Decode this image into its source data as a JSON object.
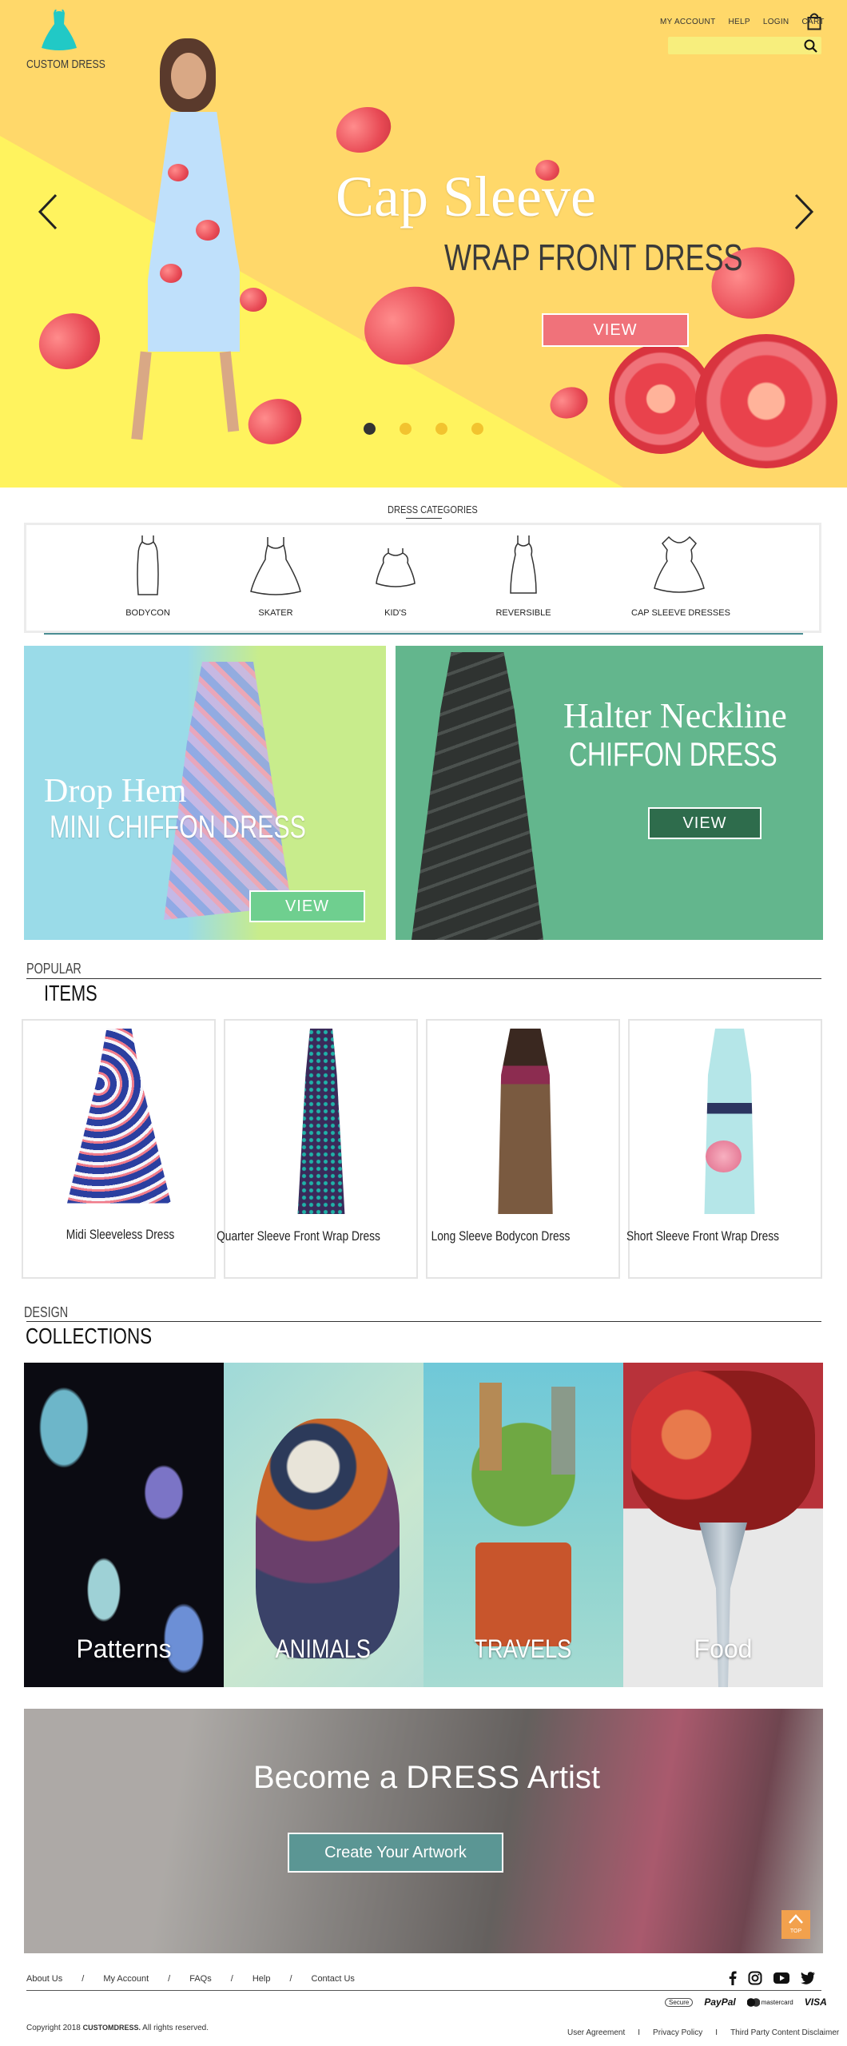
{
  "header": {
    "logo_text": "CUSTOM DRESS",
    "nav": [
      "MY ACCOUNT",
      "HELP",
      "LOGIN",
      "CART"
    ],
    "search_placeholder": ""
  },
  "hero": {
    "title": "Cap Sleeve",
    "subtitle": "WRAP FRONT DRESS",
    "button": "VIEW",
    "slides": 4,
    "active_slide": 1,
    "colors": {
      "bg": "#ffd86a",
      "accent": "#f0727a"
    }
  },
  "categories": {
    "heading": "DRESS CATEGORIES",
    "items": [
      {
        "label": "BODYCON",
        "icon": "bodycon-dress-icon"
      },
      {
        "label": "SKATER",
        "icon": "skater-dress-icon"
      },
      {
        "label": "KID'S",
        "icon": "kids-dress-icon"
      },
      {
        "label": "REVERSIBLE",
        "icon": "reversible-dress-icon"
      },
      {
        "label": "CAP SLEEVE DRESSES",
        "icon": "cap-sleeve-dress-icon"
      }
    ]
  },
  "promos": [
    {
      "title": "Drop Hem",
      "subtitle": "MINI CHIFFON DRESS",
      "button": "VIEW",
      "bg": "#9adbe8",
      "btn_color": "#6fcf8f"
    },
    {
      "title": "Halter Neckline",
      "subtitle": "CHIFFON DRESS",
      "button": "VIEW",
      "bg": "#63b68d",
      "btn_color": "#2e6c4c"
    }
  ],
  "popular": {
    "label_small": "POPULAR",
    "label_big": "ITEMS",
    "items": [
      "Midi Sleeveless Dress",
      "Quarter Sleeve Front Wrap Dress",
      "Long Sleeve Bodycon Dress",
      "Short Sleeve Front Wrap Dress"
    ]
  },
  "collections": {
    "label_small": "DESIGN",
    "label_big": "COLLECTIONS",
    "items": [
      "Patterns",
      "ANIMALS",
      "TRAVELS",
      "Food"
    ]
  },
  "artist": {
    "title_pre": "Become a ",
    "title_bold": "DRESS",
    "title_post": " Artist",
    "button": "Create Your Artwork",
    "top_label": "TOP"
  },
  "footer": {
    "links": [
      "About Us",
      "My Account",
      "FAQs",
      "Help",
      "Contact Us"
    ],
    "social": [
      "facebook-icon",
      "instagram-icon",
      "youtube-icon",
      "twitter-icon"
    ],
    "payments": [
      "Secure",
      "PayPal",
      "mastercard",
      "VISA"
    ],
    "copyright_pre": "Copyright 2018 ",
    "copyright_brand": "CUSTOMDRESS.",
    "copyright_post": " All rights reserved.",
    "legal": [
      "User Agreement",
      "Privacy Policy",
      "Third Party Content Disclaimer"
    ]
  }
}
